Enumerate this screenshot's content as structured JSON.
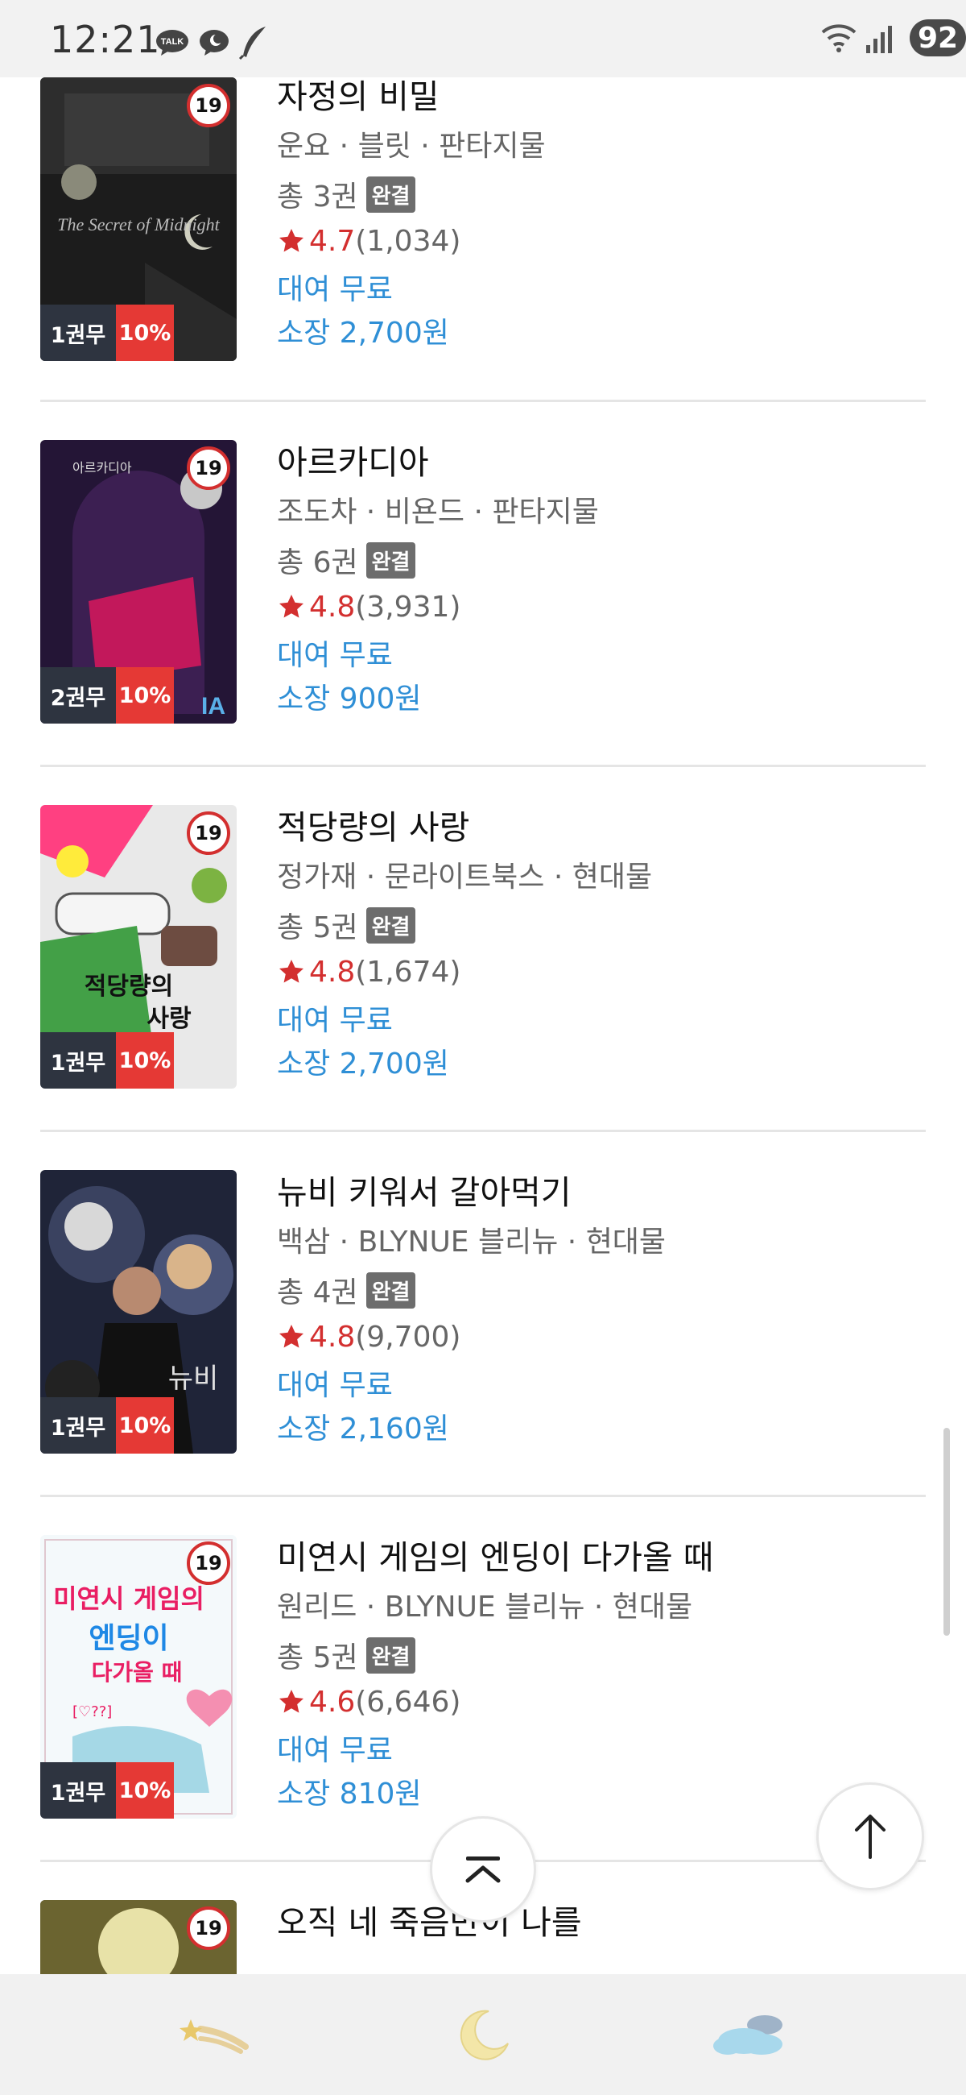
{
  "status_bar": {
    "time": "12:21",
    "notifications": [
      "talk-icon",
      "chat-moon-icon",
      "feather-icon"
    ],
    "battery": "92",
    "indicators": [
      "wifi-icon",
      "signal-icon"
    ]
  },
  "badge_text": {
    "age": "19",
    "complete": "완결"
  },
  "books": [
    {
      "title": "자정의 비밀",
      "meta": "운요 · 블릿 · 판타지물",
      "volumes": "총 3권",
      "rating": "4.7",
      "rating_count": "(1,034)",
      "rent": "대여 무료",
      "own": "소장 2,700원",
      "free_badge": "1권무",
      "discount": "10%",
      "cover_colors": [
        "#1a1a1a",
        "#3a3a3a"
      ]
    },
    {
      "title": "아르카디아",
      "meta": "조도차 · 비욘드 · 판타지물",
      "volumes": "총 6권",
      "rating": "4.8",
      "rating_count": "(3,931)",
      "rent": "대여 무료",
      "own": "소장 900원",
      "free_badge": "2권무",
      "discount": "10%",
      "cover_colors": [
        "#2a1640",
        "#c2185b"
      ]
    },
    {
      "title": "적당량의 사랑",
      "meta": "정가재 · 문라이트북스 · 현대물",
      "volumes": "총 5권",
      "rating": "4.8",
      "rating_count": "(1,674)",
      "rent": "대여 무료",
      "own": "소장 2,700원",
      "free_badge": "1권무",
      "discount": "10%",
      "cover_colors": [
        "#e8e8e8",
        "#4caf50"
      ]
    },
    {
      "title": "뉴비 키워서 갈아먹기",
      "meta": "백삼 · BLYNUE 블리뉴 · 현대물",
      "volumes": "총 4권",
      "rating": "4.8",
      "rating_count": "(9,700)",
      "rent": "대여 무료",
      "own": "소장 2,160원",
      "free_badge": "1권무",
      "discount": "10%",
      "cover_colors": [
        "#1f2438",
        "#5a6a9a"
      ]
    },
    {
      "title": "미연시 게임의 엔딩이 다가올 때",
      "meta": "원리드 · BLYNUE 블리뉴 · 현대물",
      "volumes": "총 5권",
      "rating": "4.6",
      "rating_count": "(6,646)",
      "rent": "대여 무료",
      "own": "소장 810원",
      "free_badge": "1권무",
      "discount": "10%",
      "cover_colors": [
        "#f4f9fb",
        "#f48fb1"
      ]
    },
    {
      "title": "오직 네 죽음만이 나를",
      "meta": "",
      "cover_colors": [
        "#3b3a20",
        "#e8e2a8"
      ]
    }
  ],
  "bottom_nav": [
    "shooting-star-icon",
    "moon-icon",
    "cloud-icon"
  ],
  "colors": {
    "rating": "#d32f2f",
    "link": "#2f8fd6",
    "discount": "#e53935",
    "free": "#2e3440"
  }
}
